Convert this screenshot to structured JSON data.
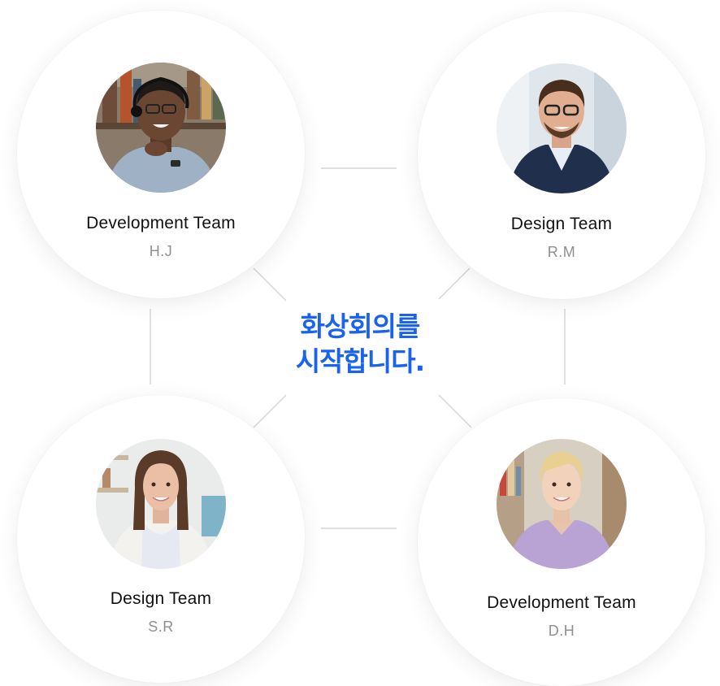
{
  "headline": {
    "line1": "화상회의를",
    "line2": "시작합니다."
  },
  "colors": {
    "accent": "#1a63f0",
    "team_text": "#111111",
    "initials_text": "#8f8f8f",
    "connector": "#d6d6d6"
  },
  "participants": [
    {
      "team": "Development Team",
      "initials": "H.J"
    },
    {
      "team": "Design Team",
      "initials": "R.M"
    },
    {
      "team": "Design Team",
      "initials": "S.R"
    },
    {
      "team": "Development Team",
      "initials": "D.H"
    }
  ]
}
